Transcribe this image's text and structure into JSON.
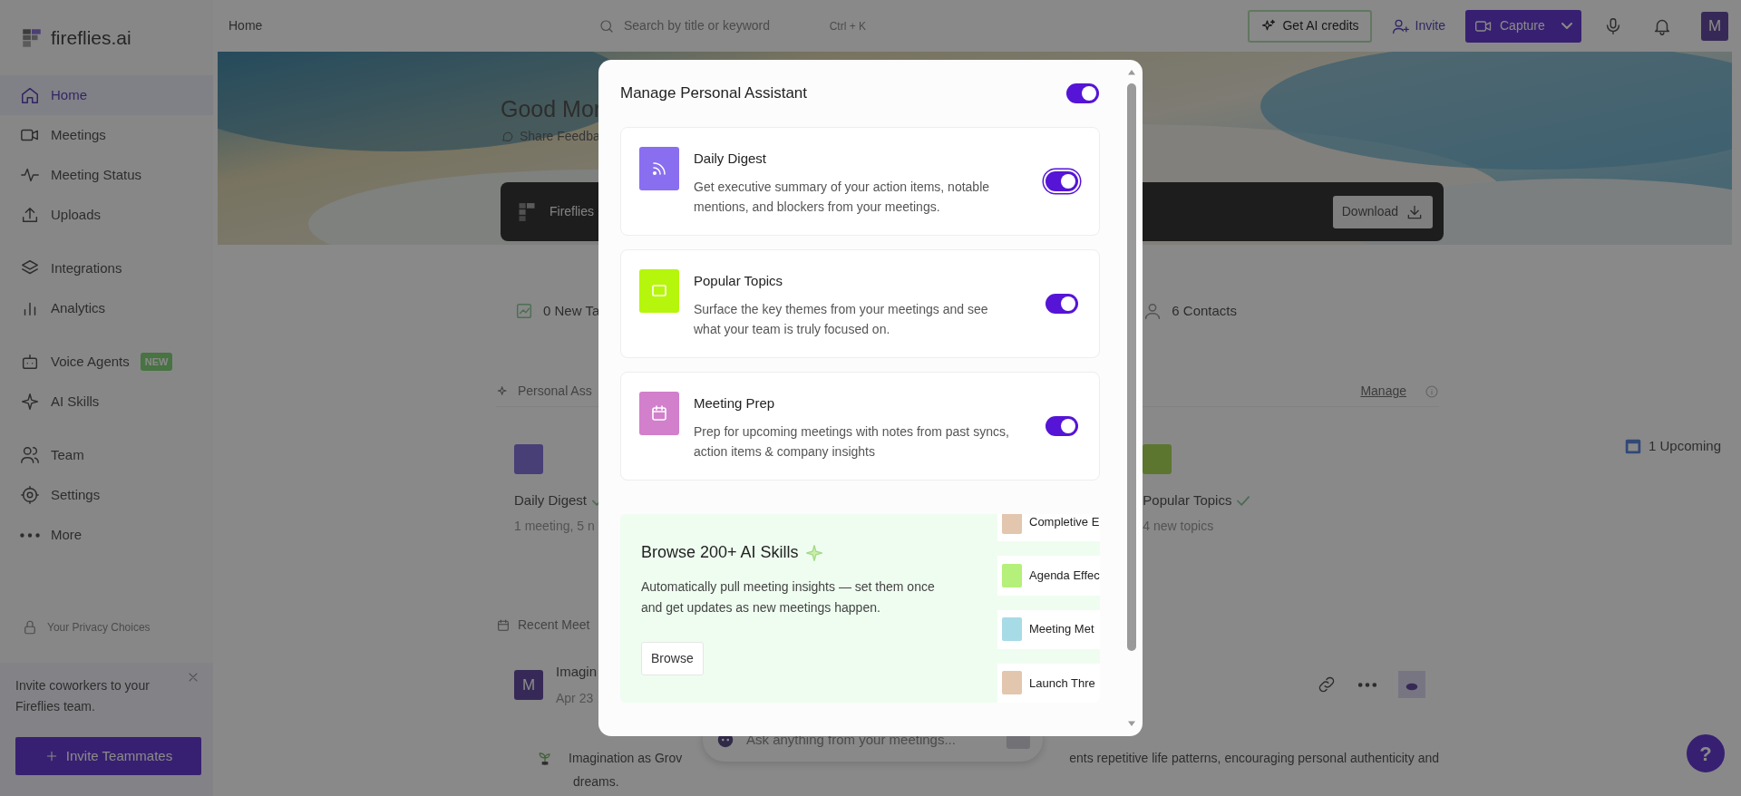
{
  "app": {
    "logo": "fireflies.ai"
  },
  "topbar": {
    "breadcrumb": "Home",
    "search": {
      "placeholder": "Search by title or keyword",
      "shortcut": "Ctrl + K"
    },
    "buttons": [
      {
        "label": "Get AI credits",
        "kind": "credits"
      },
      {
        "label": "Invite",
        "kind": "invite"
      },
      {
        "label": "Capture",
        "kind": "capture"
      }
    ],
    "avatar": "M"
  },
  "sidebar": {
    "sections": [
      {
        "items": [
          {
            "label": "Home",
            "selected": true
          },
          {
            "label": "Meetings",
            "selected": false
          },
          {
            "label": "Meeting Status",
            "selected": false
          },
          {
            "label": "Uploads",
            "selected": false
          }
        ]
      },
      {
        "items": [
          {
            "label": "Integrations",
            "selected": false
          },
          {
            "label": "Analytics",
            "selected": false
          }
        ]
      },
      {
        "items": [
          {
            "label": "Voice Agents",
            "selected": false,
            "badge": "NEW"
          },
          {
            "label": "AI Skills",
            "selected": false
          }
        ]
      },
      {
        "items": [
          {
            "label": "Team",
            "selected": false
          },
          {
            "label": "Settings",
            "selected": false
          },
          {
            "label": "More",
            "selected": false
          }
        ]
      }
    ],
    "privacy": "Your Privacy Choices",
    "invite_card": {
      "text": "Invite coworkers to your Fireflies team.",
      "button": "Invite Teammates"
    }
  },
  "home": {
    "greeting": "Good Mor",
    "feedback": "Share Feedba",
    "app_banner": {
      "title": "Fireflies",
      "button": "Download"
    },
    "stats": [
      "0 New Ta",
      "6 Contacts"
    ],
    "assistant": {
      "title": "Personal Ass",
      "manage": "Manage",
      "cards": [
        {
          "title": "Daily Digest",
          "subtitle": "1 meeting, 5 n"
        },
        {
          "title": "Popular Topics",
          "subtitle": "4 new topics"
        }
      ],
      "upcoming": "1 Upcoming"
    },
    "recent": {
      "title": "Recent Meet",
      "meeting": {
        "avatar": "M",
        "title": "Imagin",
        "date": "Apr 23",
        "summary_start": "Imagination as Grov",
        "summary_end": "ents repetitive life patterns, encouraging personal authenticity and",
        "summary_last": "dreams."
      }
    },
    "ask": {
      "placeholder": "Ask anything from your meetings..."
    },
    "help": "?"
  },
  "modal": {
    "title": "Manage Personal Assistant",
    "on": true,
    "features": [
      {
        "title": "Daily Digest",
        "description": "Get executive summary of your action items, notable mentions, and blockers from your meetings.",
        "on": true,
        "focused": true,
        "color": "#8a6ef0"
      },
      {
        "title": "Popular Topics",
        "description": "Surface the key themes from your meetings and see what your team is truly focused on.",
        "on": true,
        "focused": false,
        "color": "#b6f50c"
      },
      {
        "title": "Meeting Prep",
        "description": "Prep for upcoming meetings with notes from past syncs, action items & company insights",
        "on": true,
        "focused": false,
        "color": "#d27fcc"
      }
    ],
    "browse": {
      "title": "Browse 200+ AI Skills",
      "description": "Automatically pull meeting insights — set them once and get updates as new meetings happen.",
      "button": "Browse",
      "skills": [
        {
          "label": "Completive E",
          "color": "#e3c6ae"
        },
        {
          "label": "Agenda Effec",
          "color": "#b4f07a"
        },
        {
          "label": "Meeting Met",
          "color": "#a7dbe6"
        },
        {
          "label": "Launch Thre",
          "color": "#e3c6ae"
        }
      ]
    }
  }
}
